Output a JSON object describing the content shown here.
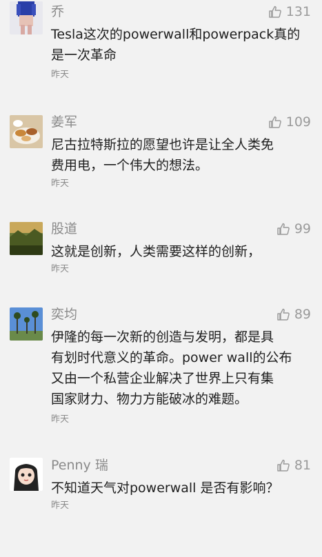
{
  "comments": [
    {
      "avatar": "girl-avatar",
      "username": "乔",
      "likes": "131",
      "lines": [
        "Tesla这次的powerwall和powerpack真的",
        "是一次革命"
      ],
      "time": "昨天"
    },
    {
      "avatar": "food-avatar",
      "username": "姜军",
      "likes": "109",
      "lines": [
        "尼古拉特斯拉的愿望也许是让全人类免",
        "费用电，一个伟大的想法。"
      ],
      "time": "昨天"
    },
    {
      "avatar": "landscape-avatar",
      "username": "股道",
      "likes": "99",
      "lines": [
        "这就是创新，人类需要这样的创新，"
      ],
      "time": "昨天"
    },
    {
      "avatar": "palm-trees-avatar",
      "username": "奕均",
      "likes": "89",
      "lines": [
        "伊隆的每一次新的创造与发明，都是具",
        "有划时代意义的革命。power wall的公布",
        "又由一个私营企业解决了世界上只有集",
        "国家财力、物力方能破冰的难题。"
      ],
      "time": "昨天"
    },
    {
      "avatar": "cartoon-girl-avatar",
      "username": "Penny 瑞",
      "likes": "81",
      "lines": [
        "不知道天气对powerwall 是否有影响？"
      ],
      "time": "昨天"
    }
  ],
  "colors": {
    "background": "#f2f2f2",
    "secondary_text": "#8a8a8a",
    "like_icon": "#9a9a9a"
  }
}
